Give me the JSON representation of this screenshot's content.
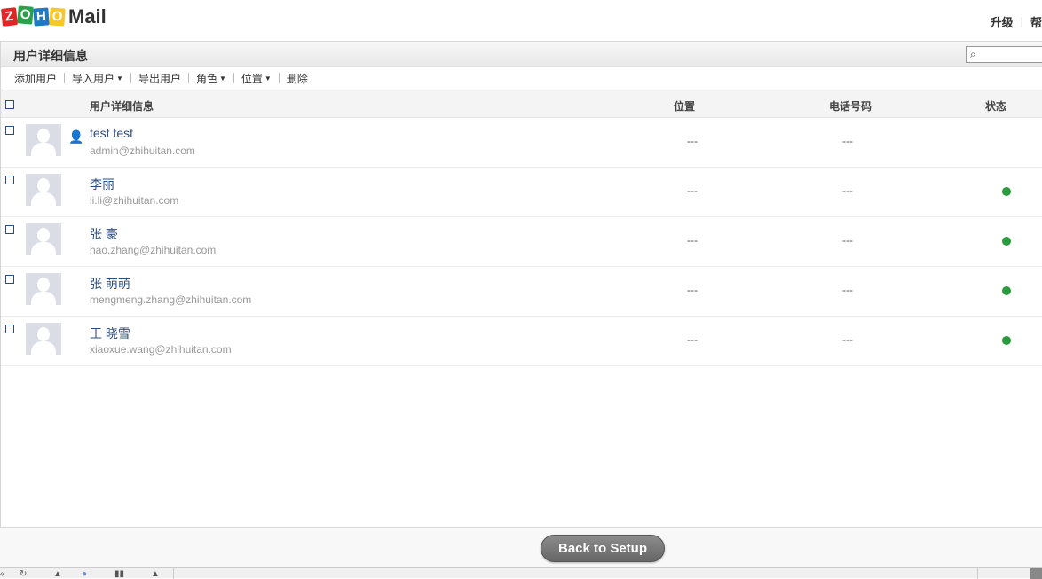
{
  "app": {
    "logo_letters": [
      "Z",
      "O",
      "H",
      "O"
    ],
    "logo_product": "Mail",
    "top_links": [
      "升级",
      "帮"
    ]
  },
  "panel": {
    "title": "用户详细信息",
    "search_icon": "search-icon"
  },
  "toolbar": {
    "items": [
      {
        "label": "添加用户",
        "dropdown": false
      },
      {
        "label": "导入用户",
        "dropdown": true
      },
      {
        "label": "导出用户",
        "dropdown": false
      },
      {
        "label": "角色",
        "dropdown": true
      },
      {
        "label": "位置",
        "dropdown": true
      },
      {
        "label": "删除",
        "dropdown": false
      }
    ]
  },
  "table": {
    "columns": {
      "details": "用户详细信息",
      "location": "位置",
      "phone": "电话号码",
      "status": "状态"
    },
    "rows": [
      {
        "name": "test test",
        "email": "admin@zhihuitan.com",
        "location": "---",
        "phone": "---",
        "is_admin": true,
        "status_active": false
      },
      {
        "name": "李丽",
        "email": "li.li@zhihuitan.com",
        "location": "---",
        "phone": "---",
        "is_admin": false,
        "status_active": true
      },
      {
        "name": "张 豪",
        "email": "hao.zhang@zhihuitan.com",
        "location": "---",
        "phone": "---",
        "is_admin": false,
        "status_active": true
      },
      {
        "name": "张 萌萌",
        "email": "mengmeng.zhang@zhihuitan.com",
        "location": "---",
        "phone": "---",
        "is_admin": false,
        "status_active": true
      },
      {
        "name": "王 晓雪",
        "email": "xiaoxue.wang@zhihuitan.com",
        "location": "---",
        "phone": "---",
        "is_admin": false,
        "status_active": true
      }
    ]
  },
  "footer": {
    "back_label": "Back to Setup"
  },
  "colors": {
    "status_active": "#2a9b3a",
    "name_link": "#2e4d7d",
    "email": "#999999"
  }
}
